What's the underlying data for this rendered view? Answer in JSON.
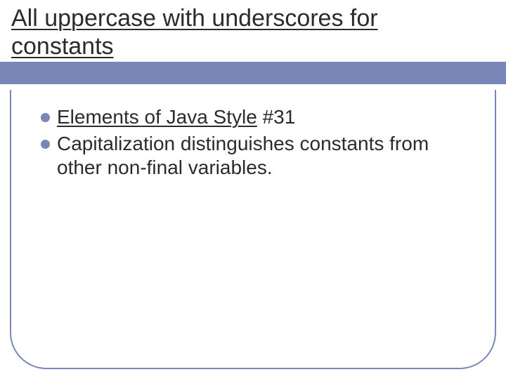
{
  "slide": {
    "title": "All uppercase with underscores for constants",
    "bullets": [
      {
        "linked_text": "Elements of Java Style",
        "rest_text": " #31"
      },
      {
        "text": "Capitalization distinguishes constants from other non-final variables."
      }
    ]
  }
}
